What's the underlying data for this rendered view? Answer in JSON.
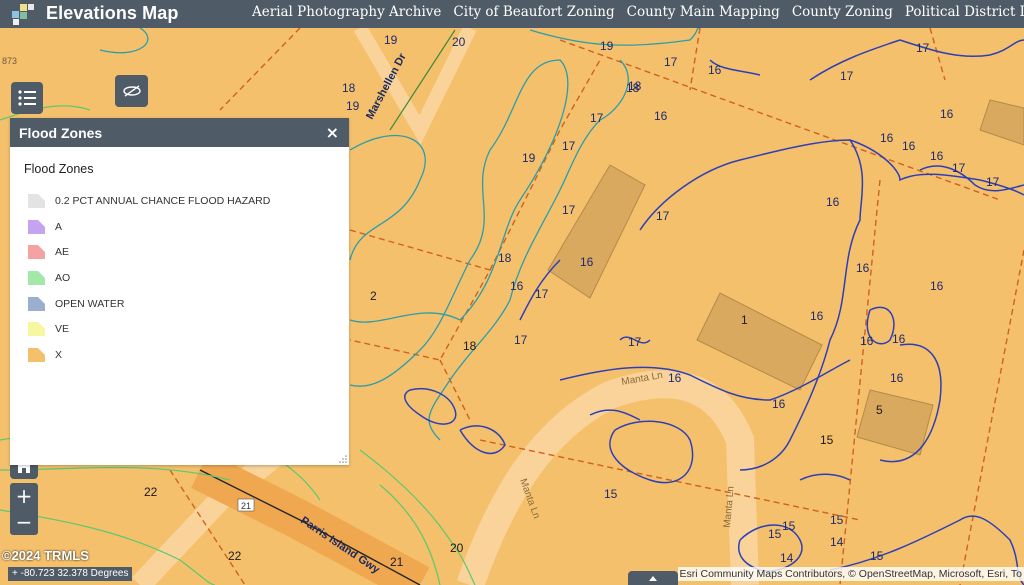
{
  "header": {
    "title": "Elevations Map",
    "nav": [
      "Aerial Photography Archive",
      "City of Beaufort Zoning",
      "County Main Mapping",
      "County Zoning",
      "Political District Lookup"
    ]
  },
  "legend_panel": {
    "title": "Flood Zones",
    "close": "×",
    "legend_title": "Flood Zones",
    "items": [
      {
        "label": "0.2 PCT ANNUAL CHANCE FLOOD HAZARD",
        "color": "#e3e3e3"
      },
      {
        "label": "A",
        "color": "#c6a3f0"
      },
      {
        "label": "AE",
        "color": "#f4a3a3"
      },
      {
        "label": "AO",
        "color": "#a3e8a8"
      },
      {
        "label": "OPEN WATER",
        "color": "#9aaecf"
      },
      {
        "label": "VE",
        "color": "#f7f7a0"
      },
      {
        "label": "X",
        "color": "#f5c06c"
      }
    ]
  },
  "map": {
    "background_color": "#f5c06c",
    "contour_labels": [
      "19",
      "20",
      "18",
      "19",
      "19",
      "18",
      "17",
      "18",
      "18",
      "17",
      "16",
      "17",
      "16",
      "17",
      "16",
      "17",
      "16",
      "17",
      "16",
      "17",
      "17",
      "17",
      "16",
      "16",
      "16",
      "16",
      "16",
      "16",
      "16",
      "16",
      "16",
      "15",
      "15",
      "15",
      "15",
      "15",
      "14",
      "15",
      "14",
      "18",
      "17",
      "17",
      "16",
      "17",
      "16",
      "16",
      "19",
      "20",
      "22",
      "21",
      "22",
      "2",
      "1",
      "5"
    ],
    "road_labels": [
      "Marshellen Dr",
      "Manta Ln",
      "Manta Ln",
      "Manta Ln",
      "Parris Island Gwy",
      "21"
    ],
    "parcel_labels": [
      "873"
    ]
  },
  "controls": {
    "zoom_in": "+",
    "zoom_out": "−"
  },
  "footer": {
    "copyright": "©2024 TRMLS",
    "coordinates": "-80.723 32.378 Degrees",
    "attribution": "Esri Community Maps Contributors, © OpenStreetMap, Microsoft, Esri, To"
  }
}
